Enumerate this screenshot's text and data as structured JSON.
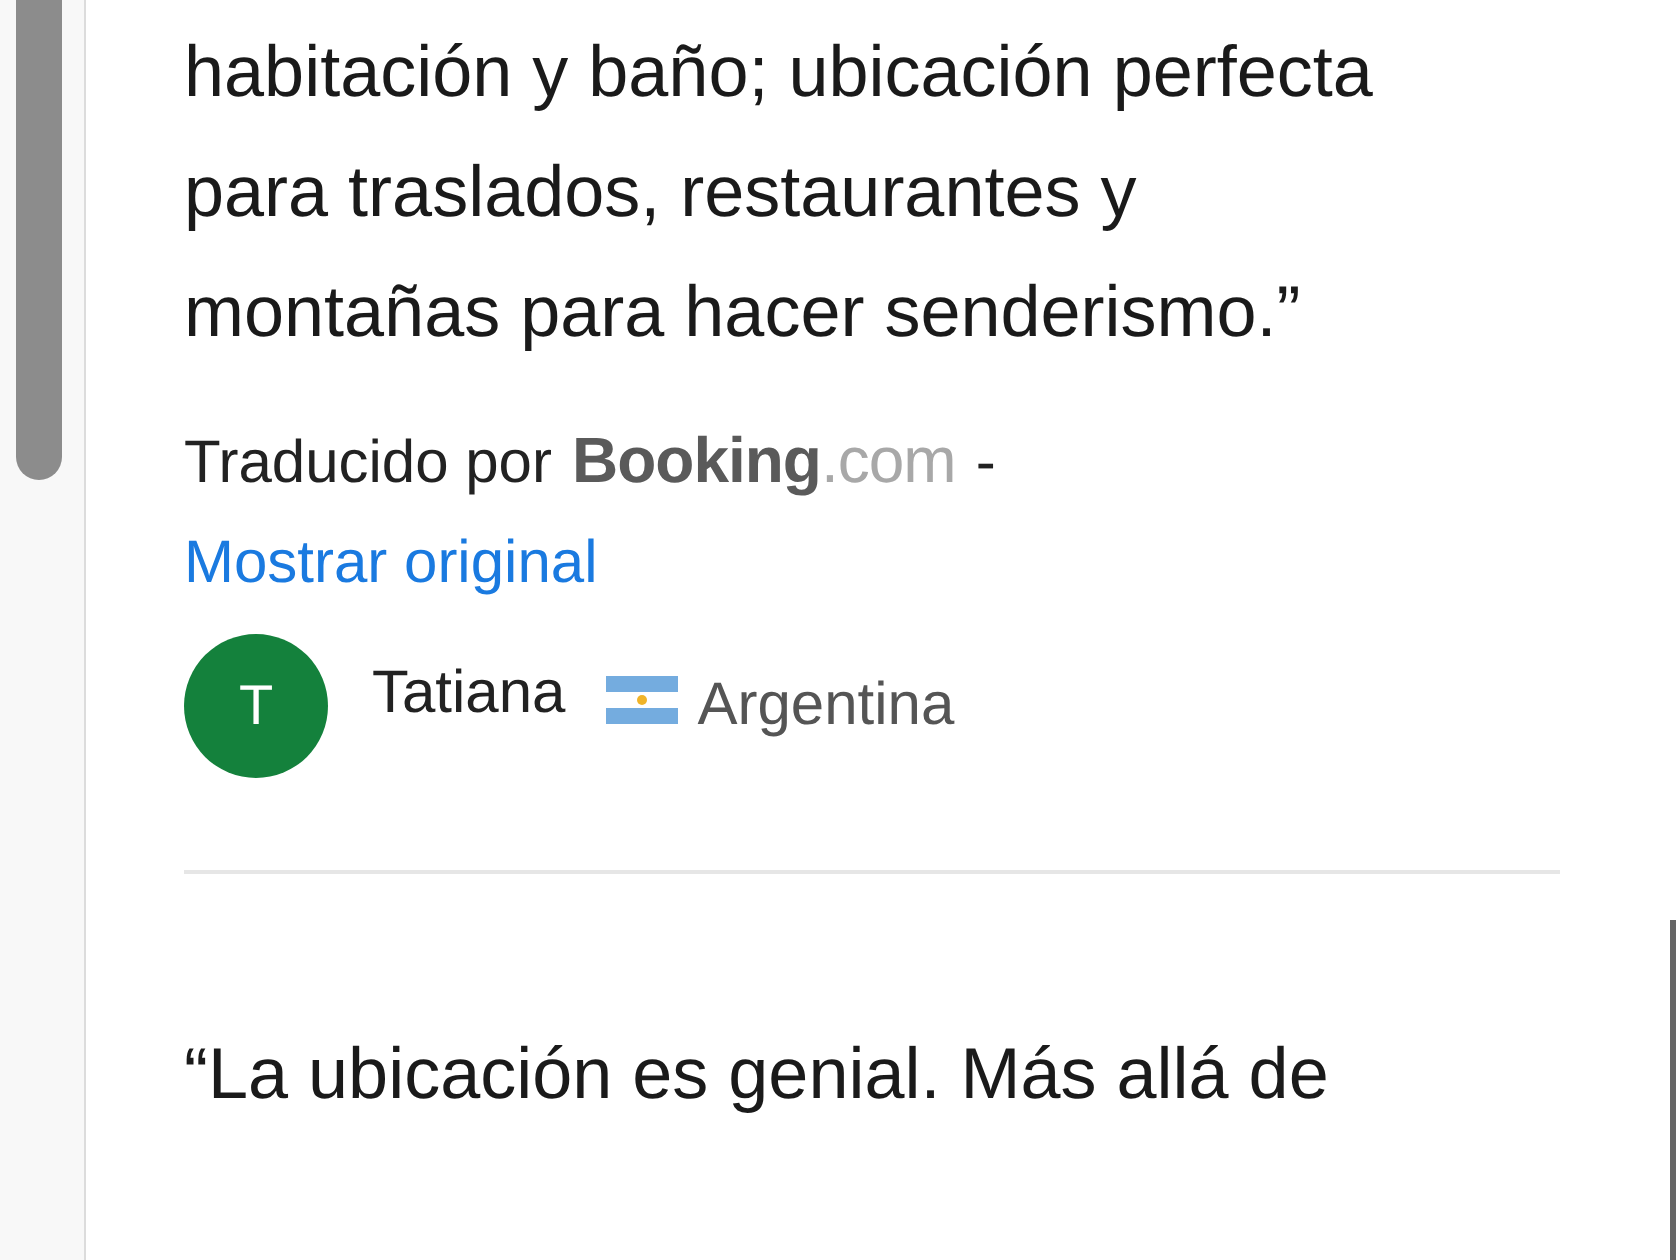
{
  "reviews": [
    {
      "text_lines": [
        "habitación y baño; ubicación perfecta",
        "para traslados, restaurantes y",
        "montañas para hacer senderismo.”"
      ],
      "translated_by": "Traducido por",
      "provider": {
        "name": "Booking",
        "suffix": ".com"
      },
      "separator": "-",
      "show_original": "Mostrar original",
      "author": {
        "initial": "T",
        "name": "Tatiana",
        "country": "Argentina"
      }
    },
    {
      "text_lines": [
        "“La ubicación es genial. Más allá de"
      ]
    }
  ]
}
